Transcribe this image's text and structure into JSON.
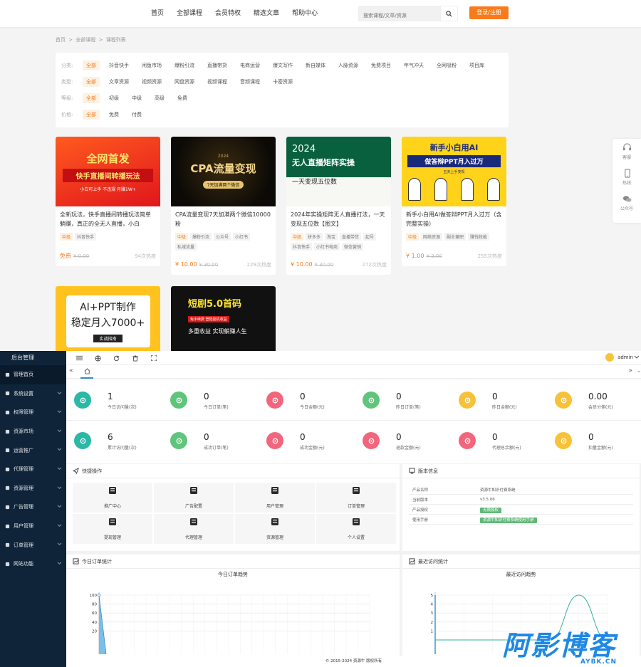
{
  "front": {
    "nav": [
      "首页",
      "全部课程",
      "会员特权",
      "精选文章",
      "帮助中心"
    ],
    "search_placeholder": "搜索课程/文章/资源",
    "login": "登录/注册",
    "breadcrumb": [
      "首页",
      ">",
      "全部课程",
      ">",
      "课程列表"
    ],
    "filters": [
      {
        "label": "分类:",
        "options": [
          "全部",
          "抖音快手",
          "闲鱼市场",
          "爆粉引流",
          "直播带货",
          "电商运营",
          "爆文写作",
          "新自媒体",
          "人脉资源",
          "免费项目",
          "年气冲天",
          "全网吸粉",
          "项目库"
        ]
      },
      {
        "label": "类型:",
        "options": [
          "全部",
          "文章资源",
          "视频资源",
          "网盘资源",
          "视频课程",
          "音频课程",
          "卡密资源"
        ]
      },
      {
        "label": "等级:",
        "options": [
          "全部",
          "初级",
          "中级",
          "高级",
          "免费"
        ]
      },
      {
        "label": "价格:",
        "options": [
          "全部",
          "免费",
          "付费"
        ]
      }
    ],
    "courses": [
      {
        "cover_line1": "全网首发",
        "cover_line2": "快手直播间转播玩法",
        "cover_line3": "小白可上手 不违规 月赚1W+",
        "title": "全新玩法，快手直播间转播玩法简单躺赚，真正的全无人直播，小白",
        "tags": [
          "中级",
          "抖音快手"
        ],
        "price": "免费",
        "old": "¥ 0.00",
        "heat": "94次热度"
      },
      {
        "cover_line1": "2024",
        "cover_line2": "CPA流量变现",
        "cover_line3": "7天加满两个微信",
        "title": "CPA流量变现7天加满两个微信10000粉",
        "tags": [
          "中级",
          "爆粉引流",
          "公众号",
          "小红书",
          "私域流量"
        ],
        "price": "¥ 10.00",
        "old": "¥ 30.00",
        "heat": "229次热度"
      },
      {
        "cover_line1": "2024",
        "cover_line2": "无人直播矩阵实操",
        "cover_line3": "一天变现五位数",
        "title": "2024年实操矩阵无人直播打法，一天变现五位数【图文】",
        "tags": [
          "中级",
          "拼多多",
          "淘宝",
          "直播带货",
          "起号",
          "抖音快手",
          "小红书电商",
          "微信营销"
        ],
        "price": "¥ 10.00",
        "old": "¥ 30.00",
        "heat": "272次热度"
      },
      {
        "cover_line1": "新手小白用AI",
        "cover_line2": "做答辩PPT月入过万",
        "cover_line3": "五天上手变现",
        "title": "新手小白用AI做答辩PPT月入过万（含完整实操）",
        "tags": [
          "中级",
          "网络资源",
          "副业兼职",
          "赚钱技能"
        ],
        "price": "¥ 1.00",
        "old": "¥ 3.00",
        "heat": "255次热度"
      },
      {
        "cover_line1": "AI+PPT制作",
        "cover_line2": "稳定月入7000+",
        "cover_line3": "实战指南"
      },
      {
        "cover_line1": "短剧5.0首码",
        "cover_line2": "免手续费 登陆挂机收益",
        "cover_line3": "多重收益 实现躺赚人生"
      }
    ],
    "side_float": [
      "客服",
      "热线",
      "公众号"
    ]
  },
  "admin": {
    "logo": "后台管理",
    "menu": [
      "管理首页",
      "系统设置",
      "权限管理",
      "资源市场",
      "运营推广",
      "代理管理",
      "资源管理",
      "广告管理",
      "用户管理",
      "订单管理",
      "网站功能"
    ],
    "user": "admin",
    "stats": [
      {
        "num": "1",
        "label": "今日访问量(次)",
        "color": "#2bb8a5"
      },
      {
        "num": "0",
        "label": "今日订单(笔)",
        "color": "#5fc57b"
      },
      {
        "num": "0",
        "label": "今日金额(元)",
        "color": "#f2667d"
      },
      {
        "num": "0",
        "label": "昨日订单(笔)",
        "color": "#5fc57b"
      },
      {
        "num": "0",
        "label": "昨日金额(元)",
        "color": "#f8c238"
      },
      {
        "num": "0.00",
        "label": "会员分佣(元)",
        "color": "#f8c238"
      },
      {
        "num": "6",
        "label": "累计访问量(次)",
        "color": "#2bb8a5"
      },
      {
        "num": "0",
        "label": "成功订单(笔)",
        "color": "#5fc57b"
      },
      {
        "num": "0",
        "label": "成功金额(元)",
        "color": "#f2667d"
      },
      {
        "num": "0",
        "label": "退款金额(元)",
        "color": "#f2667d"
      },
      {
        "num": "0",
        "label": "代理总余额(元)",
        "color": "#f2667d"
      },
      {
        "num": "0",
        "label": "扣量金额(元)",
        "color": "#f8c238"
      }
    ],
    "quick": {
      "title": "快捷操作",
      "items": [
        "推广中心",
        "广告配置",
        "用户管理",
        "订单管理",
        "提现管理",
        "代理管理",
        "资源管理",
        "个人设置"
      ]
    },
    "version": {
      "title": "版本信息",
      "rows": [
        {
          "k": "产品名称",
          "v": "资源牛知识付费系统"
        },
        {
          "k": "当前版本",
          "v": "v3.5.06"
        },
        {
          "k": "产品授权",
          "v": "无限授权"
        },
        {
          "k": "使用手册",
          "v": "资源牛知识付费系统使用手册"
        }
      ]
    },
    "order_chart": {
      "panel": "今日订单统计",
      "title": "今日订单趋势"
    },
    "visit_chart": {
      "panel": "最近访问统计",
      "title": "最近访问趋势"
    },
    "copyright": "© 2015-2024 资源牛 版权所有"
  },
  "watermark": {
    "text": "阿影博客",
    "sub": "AYBK.CN"
  },
  "chart_data": [
    {
      "type": "area",
      "title": "今日订单趋势",
      "yticks": [
        20,
        40,
        60,
        80,
        100
      ],
      "ylim": [
        0,
        100
      ],
      "x": [
        0,
        1,
        2,
        3,
        4,
        5,
        6,
        7,
        8,
        9,
        10,
        11,
        12,
        13,
        14,
        15,
        16,
        17,
        18,
        19,
        20,
        21,
        22,
        23
      ],
      "values": [
        100,
        0,
        0,
        0,
        0,
        0,
        0,
        0,
        0,
        0,
        0,
        0,
        0,
        0,
        0,
        0,
        0,
        0,
        0,
        0,
        0,
        0,
        0,
        0
      ]
    },
    {
      "type": "line",
      "title": "最近访问趋势",
      "yticks": [
        1,
        2,
        3,
        4,
        5
      ],
      "ylim": [
        0,
        5
      ],
      "x": [
        0,
        1,
        2,
        3,
        4,
        5,
        6
      ],
      "values": [
        0,
        0,
        0,
        0,
        0,
        5,
        0
      ]
    }
  ]
}
